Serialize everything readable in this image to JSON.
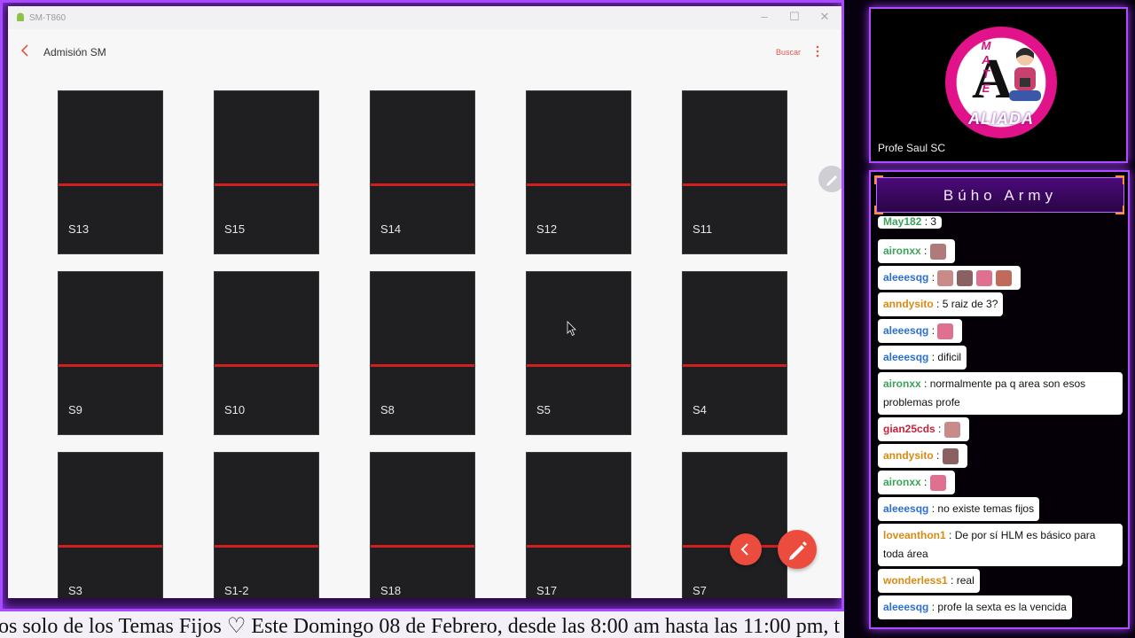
{
  "window": {
    "title": "SM-T860",
    "minimize_glyph": "–",
    "maximize_glyph": "☐",
    "close_glyph": "✕"
  },
  "appbar": {
    "title": "Admisión SM",
    "search_label": "Buscar"
  },
  "tiles": [
    "S13",
    "S15",
    "S14",
    "S12",
    "S11",
    "S9",
    "S10",
    "S8",
    "S5",
    "S4",
    "S3",
    "S1-2",
    "S18",
    "S17",
    "S7"
  ],
  "ticker": {
    "text": "os solo de los Temas Fijos ♡  Este Domingo 08 de Febrero, desde las 8:00 am hasta las 11:00 pm, t"
  },
  "camera": {
    "logo_letter": "A",
    "logo_mate": "MATE",
    "logo_aliada": "ALIADA",
    "streamer_name": "Profe Saul SC"
  },
  "chat": {
    "header": "Búho Army",
    "messages": [
      {
        "user": "May182",
        "text": "3",
        "color": "#3aa35a",
        "emotes": 0
      },
      {
        "user": "aironxx",
        "text": "",
        "color": "#3aa35a",
        "emotes": 1
      },
      {
        "user": "aleeesqg",
        "text": "",
        "color": "#2a6fd6",
        "emotes": 4
      },
      {
        "user": "anndysito",
        "text": "5 raiz de 3?",
        "color": "#d98a14",
        "emotes": 0
      },
      {
        "user": "aleeesqg",
        "text": "",
        "color": "#2a6fd6",
        "emotes": 1
      },
      {
        "user": "aleeesqg",
        "text": "dificil",
        "color": "#2a6fd6",
        "emotes": 0
      },
      {
        "user": "aironxx",
        "text": "normalmente pa q area son esos problemas profe",
        "color": "#3aa35a",
        "emotes": 0
      },
      {
        "user": "gian25cds",
        "text": "",
        "color": "#c4233a",
        "emotes": 1
      },
      {
        "user": "anndysito",
        "text": "",
        "color": "#d98a14",
        "emotes": 1
      },
      {
        "user": "aironxx",
        "text": "",
        "color": "#3aa35a",
        "emotes": 1
      },
      {
        "user": "aleeesqg",
        "text": "no existe temas fijos",
        "color": "#2a6fd6",
        "emotes": 0
      },
      {
        "user": "loveanthon1",
        "text": "De por sí HLM es básico para toda área",
        "color": "#d98a14",
        "emotes": 0
      },
      {
        "user": "wonderless1",
        "text": "real",
        "color": "#d98a14",
        "emotes": 0
      },
      {
        "user": "aleeesqg",
        "text": "profe la sexta es la vencida",
        "color": "#2a6fd6",
        "emotes": 0
      }
    ]
  }
}
